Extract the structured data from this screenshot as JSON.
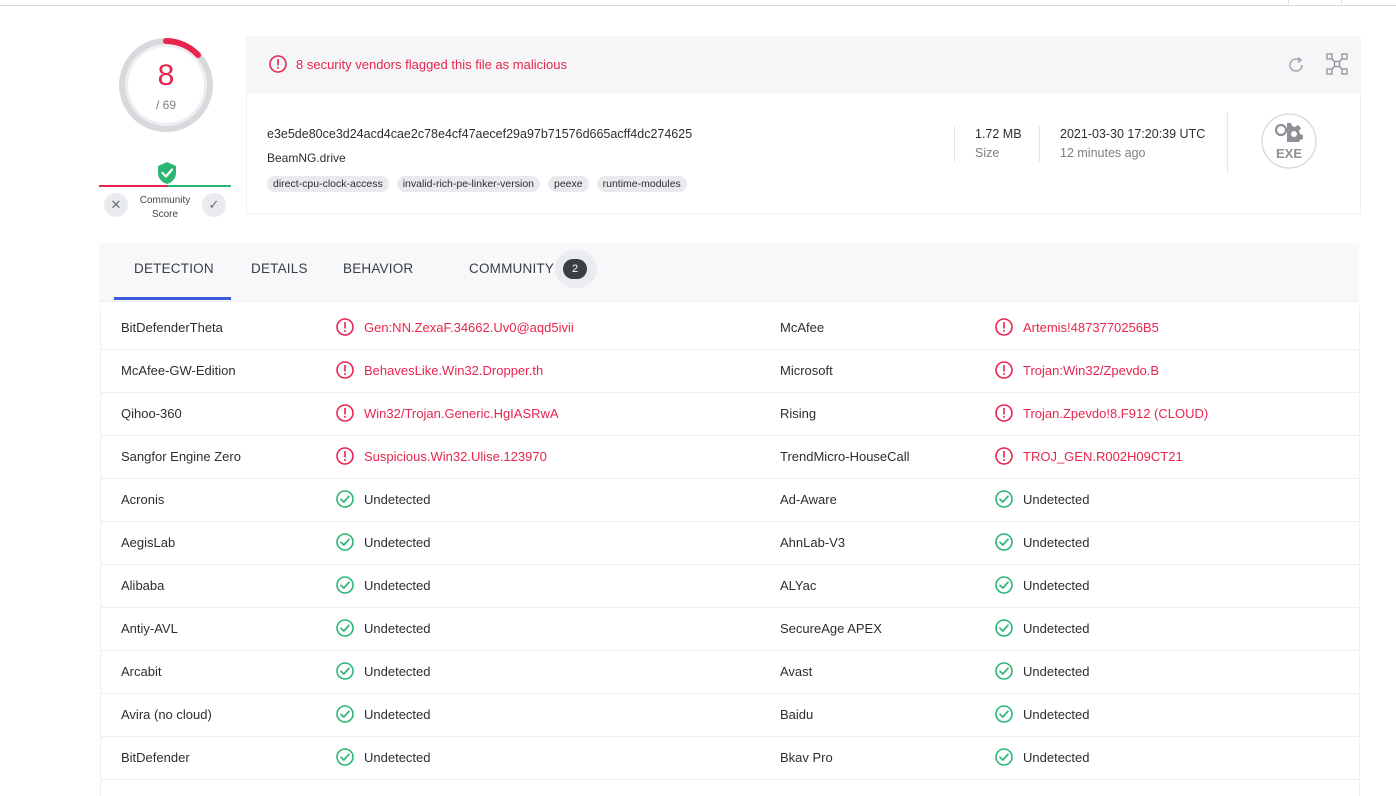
{
  "score": {
    "detections": "8",
    "total": "/ 69"
  },
  "community": {
    "label": "Community Score",
    "negative_symbol": "✕",
    "positive_symbol": "✓"
  },
  "alert": {
    "text": "8 security vendors flagged this file as malicious"
  },
  "file": {
    "hash": "e3e5de80ce3d24acd4cae2c78e4cf47aecef29a97b71576d665acff4dc274625",
    "name": "BeamNG.drive",
    "tags": [
      "direct-cpu-clock-access",
      "invalid-rich-pe-linker-version",
      "peexe",
      "runtime-modules"
    ],
    "size": "1.72 MB",
    "size_label": "Size",
    "date": "2021-03-30 17:20:39 UTC",
    "date_ago": "12 minutes ago",
    "type": "EXE"
  },
  "tabs": {
    "detection": "DETECTION",
    "details": "DETAILS",
    "behavior": "BEHAVIOR",
    "community": "COMMUNITY",
    "community_count": "2"
  },
  "colors": {
    "malicious": "#e8254f",
    "clean": "#2bb673",
    "active_tab": "#3b5bdb"
  },
  "rows": [
    {
      "left": {
        "engine": "BitDefenderTheta",
        "result": "Gen:NN.ZexaF.34662.Uv0@aqd5ivii",
        "status": "malicious"
      },
      "right": {
        "engine": "McAfee",
        "result": "Artemis!4873770256B5",
        "status": "malicious"
      }
    },
    {
      "left": {
        "engine": "McAfee-GW-Edition",
        "result": "BehavesLike.Win32.Dropper.th",
        "status": "malicious"
      },
      "right": {
        "engine": "Microsoft",
        "result": "Trojan:Win32/Zpevdo.B",
        "status": "malicious"
      }
    },
    {
      "left": {
        "engine": "Qihoo-360",
        "result": "Win32/Trojan.Generic.HgIASRwA",
        "status": "malicious"
      },
      "right": {
        "engine": "Rising",
        "result": "Trojan.Zpevdo!8.F912 (CLOUD)",
        "status": "malicious"
      }
    },
    {
      "left": {
        "engine": "Sangfor Engine Zero",
        "result": "Suspicious.Win32.Ulise.123970",
        "status": "malicious"
      },
      "right": {
        "engine": "TrendMicro-HouseCall",
        "result": "TROJ_GEN.R002H09CT21",
        "status": "malicious"
      }
    },
    {
      "left": {
        "engine": "Acronis",
        "result": "Undetected",
        "status": "clean"
      },
      "right": {
        "engine": "Ad-Aware",
        "result": "Undetected",
        "status": "clean"
      }
    },
    {
      "left": {
        "engine": "AegisLab",
        "result": "Undetected",
        "status": "clean"
      },
      "right": {
        "engine": "AhnLab-V3",
        "result": "Undetected",
        "status": "clean"
      }
    },
    {
      "left": {
        "engine": "Alibaba",
        "result": "Undetected",
        "status": "clean"
      },
      "right": {
        "engine": "ALYac",
        "result": "Undetected",
        "status": "clean"
      }
    },
    {
      "left": {
        "engine": "Antiy-AVL",
        "result": "Undetected",
        "status": "clean"
      },
      "right": {
        "engine": "SecureAge APEX",
        "result": "Undetected",
        "status": "clean"
      }
    },
    {
      "left": {
        "engine": "Arcabit",
        "result": "Undetected",
        "status": "clean"
      },
      "right": {
        "engine": "Avast",
        "result": "Undetected",
        "status": "clean"
      }
    },
    {
      "left": {
        "engine": "Avira (no cloud)",
        "result": "Undetected",
        "status": "clean"
      },
      "right": {
        "engine": "Baidu",
        "result": "Undetected",
        "status": "clean"
      }
    },
    {
      "left": {
        "engine": "BitDefender",
        "result": "Undetected",
        "status": "clean"
      },
      "right": {
        "engine": "Bkav Pro",
        "result": "Undetected",
        "status": "clean"
      }
    }
  ]
}
